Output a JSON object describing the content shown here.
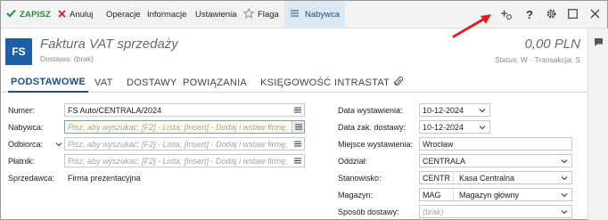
{
  "toolbar": {
    "save_label": "ZAPISZ",
    "cancel_label": "Anuluj",
    "operations_label": "Operacje",
    "information_label": "Informacje",
    "settings_label": "Ustawienia",
    "flag_label": "Flaga",
    "buyer_label": "Nabywca",
    "help_label": "?",
    "icons": [
      "check-icon",
      "close-x-icon",
      "star-icon",
      "hamburger-menu-icon",
      "add-contact-icon",
      "help-icon",
      "gear-icon",
      "maximize-icon",
      "close-icon"
    ]
  },
  "header": {
    "badge": "FS",
    "title": "Faktura VAT sprzedaży",
    "subtitle": "Dostawa: (brak)",
    "amount": "0,00 PLN",
    "status": "Status: W  ·  Transakcja: S"
  },
  "tabs": [
    {
      "label": "PODSTAWOWE",
      "active": true
    },
    {
      "label": "VAT",
      "active": false
    },
    {
      "label": "DOSTAWY",
      "active": false
    },
    {
      "label": "POWIĄZANIA",
      "active": false
    },
    {
      "label": "KSIĘGOWOŚĆ",
      "active": false
    },
    {
      "label": "INTRASTAT",
      "active": false
    }
  ],
  "left_form": {
    "number": {
      "label": "Numer:",
      "value": "FS Auto/CENTRALA/2024"
    },
    "buyer": {
      "label": "Nabywca:",
      "placeholder": "Pisz, aby wyszukać; [F2] - Lista; [Insert] - Dodaj i wstaw firmę;"
    },
    "recipient": {
      "label": "Odbiorca:",
      "placeholder": "Pisz, aby wyszukać; [F2] - Lista; [Insert] - Dodaj i wstaw firmę;"
    },
    "payer": {
      "label": "Płatnik:",
      "placeholder": "Pisz, aby wyszukać; [F2] - Lista; [Insert] - Dodaj i wstaw firmę;"
    },
    "seller": {
      "label": "Sprzedawca:",
      "value": "Firma prezentacyjna"
    }
  },
  "right_form": {
    "issue_date": {
      "label": "Data wystawienia:",
      "value": "10-12-2024"
    },
    "delivery_date": {
      "label": "Data zak. dostawy:",
      "value": "10-12-2024"
    },
    "place": {
      "label": "Miejsce wystawienia:",
      "value": "Wrocław"
    },
    "branch": {
      "label": "Oddział:",
      "value": "CENTRALA"
    },
    "station": {
      "label": "Stanowisko:",
      "code": "CENTR",
      "name": "Kasa Centralna"
    },
    "warehouse": {
      "label": "Magazyn:",
      "code": "MAG",
      "name": "Magazyn główny"
    },
    "delivery_method": {
      "label": "Sposób dostawy:",
      "placeholder": "(brak)"
    }
  },
  "colors": {
    "accent": "#1f5fa8",
    "save_green": "#2a8a2a",
    "cancel_red": "#d02020",
    "annotation_arrow": "#e02020",
    "focus_field_bg": "#fffdea"
  }
}
